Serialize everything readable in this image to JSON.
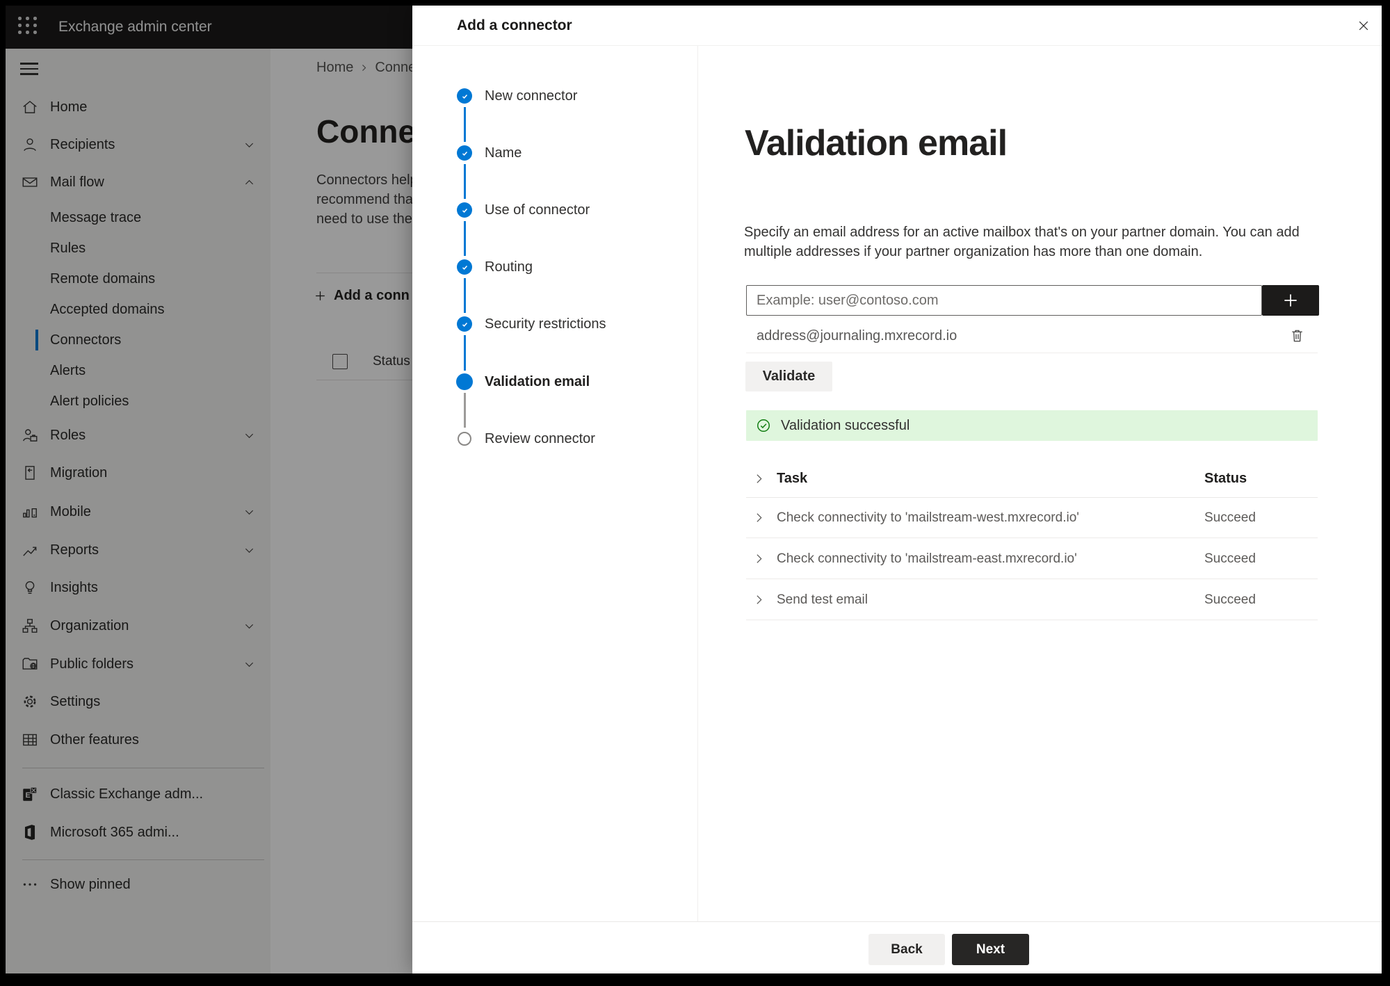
{
  "app_bar": {
    "title": "Exchange admin center"
  },
  "sidebar": {
    "items": [
      {
        "label": "Home",
        "icon": "home",
        "sub": false,
        "chevron": null,
        "selected": false
      },
      {
        "label": "Recipients",
        "icon": "person",
        "sub": false,
        "chevron": "down",
        "selected": false
      },
      {
        "label": "Mail flow",
        "icon": "mail",
        "sub": false,
        "chevron": "up",
        "selected": false
      },
      {
        "label": "Message trace",
        "icon": null,
        "sub": true,
        "chevron": null,
        "selected": false
      },
      {
        "label": "Rules",
        "icon": null,
        "sub": true,
        "chevron": null,
        "selected": false
      },
      {
        "label": "Remote domains",
        "icon": null,
        "sub": true,
        "chevron": null,
        "selected": false
      },
      {
        "label": "Accepted domains",
        "icon": null,
        "sub": true,
        "chevron": null,
        "selected": false
      },
      {
        "label": "Connectors",
        "icon": null,
        "sub": true,
        "chevron": null,
        "selected": true
      },
      {
        "label": "Alerts",
        "icon": null,
        "sub": true,
        "chevron": null,
        "selected": false
      },
      {
        "label": "Alert policies",
        "icon": null,
        "sub": true,
        "chevron": null,
        "selected": false
      },
      {
        "label": "Roles",
        "icon": "roles",
        "sub": false,
        "chevron": "down",
        "selected": false
      },
      {
        "label": "Migration",
        "icon": "migration",
        "sub": false,
        "chevron": null,
        "selected": false
      },
      {
        "label": "Mobile",
        "icon": "mobile",
        "sub": false,
        "chevron": "down",
        "selected": false
      },
      {
        "label": "Reports",
        "icon": "reports",
        "sub": false,
        "chevron": "down",
        "selected": false
      },
      {
        "label": "Insights",
        "icon": "insights",
        "sub": false,
        "chevron": null,
        "selected": false
      },
      {
        "label": "Organization",
        "icon": "organization",
        "sub": false,
        "chevron": "down",
        "selected": false
      },
      {
        "label": "Public folders",
        "icon": "public-folders",
        "sub": false,
        "chevron": "down",
        "selected": false
      },
      {
        "label": "Settings",
        "icon": "settings",
        "sub": false,
        "chevron": null,
        "selected": false
      },
      {
        "label": "Other features",
        "icon": "other-features",
        "sub": false,
        "chevron": null,
        "selected": false
      },
      {
        "label": "Classic Exchange adm...",
        "icon": "classic-exchange",
        "sub": false,
        "chevron": null,
        "selected": false
      },
      {
        "label": "Microsoft 365 admi...",
        "icon": "microsoft-365",
        "sub": false,
        "chevron": null,
        "selected": false
      },
      {
        "label": "Show pinned",
        "icon": "show-pinned",
        "sub": false,
        "chevron": null,
        "selected": false
      }
    ]
  },
  "background_page": {
    "breadcrumb": {
      "items": [
        "Home",
        "Conne"
      ]
    },
    "heading": "Connec",
    "intro_lines": [
      "Connectors help",
      "recommend that",
      "need to use ther"
    ],
    "add_button_label": "Add a conn",
    "status_header": "Status"
  },
  "dialog": {
    "title": "Add a connector",
    "steps": [
      {
        "label": "New connector",
        "state": "done"
      },
      {
        "label": "Name",
        "state": "done"
      },
      {
        "label": "Use of connector",
        "state": "done"
      },
      {
        "label": "Routing",
        "state": "done"
      },
      {
        "label": "Security restrictions",
        "state": "done"
      },
      {
        "label": "Validation email",
        "state": "current"
      },
      {
        "label": "Review connector",
        "state": "todo"
      }
    ],
    "content": {
      "heading": "Validation email",
      "description_lines": [
        "Specify an email address for an active mailbox that's on your partner domain. You can add",
        "multiple addresses if your partner organization has more than one domain."
      ],
      "email_input": {
        "placeholder": "Example: user@contoso.com"
      },
      "added_address": "address@journaling.mxrecord.io",
      "validate_button_label": "Validate",
      "success_banner": "Validation successful",
      "results_table": {
        "columns": [
          "Task",
          "Status"
        ],
        "rows": [
          {
            "task": "Check connectivity to 'mailstream-west.mxrecord.io'",
            "status": "Succeed"
          },
          {
            "task": "Check connectivity to 'mailstream-east.mxrecord.io'",
            "status": "Succeed"
          },
          {
            "task": "Send test email",
            "status": "Succeed"
          }
        ]
      },
      "back_button_label": "Back",
      "next_button_label": "Next"
    }
  },
  "colors": {
    "accent_blue": "#0078d4",
    "success_green": "#107c10",
    "success_banner_bg": "#dff6dd",
    "app_bar_bg": "#1b1a19"
  }
}
